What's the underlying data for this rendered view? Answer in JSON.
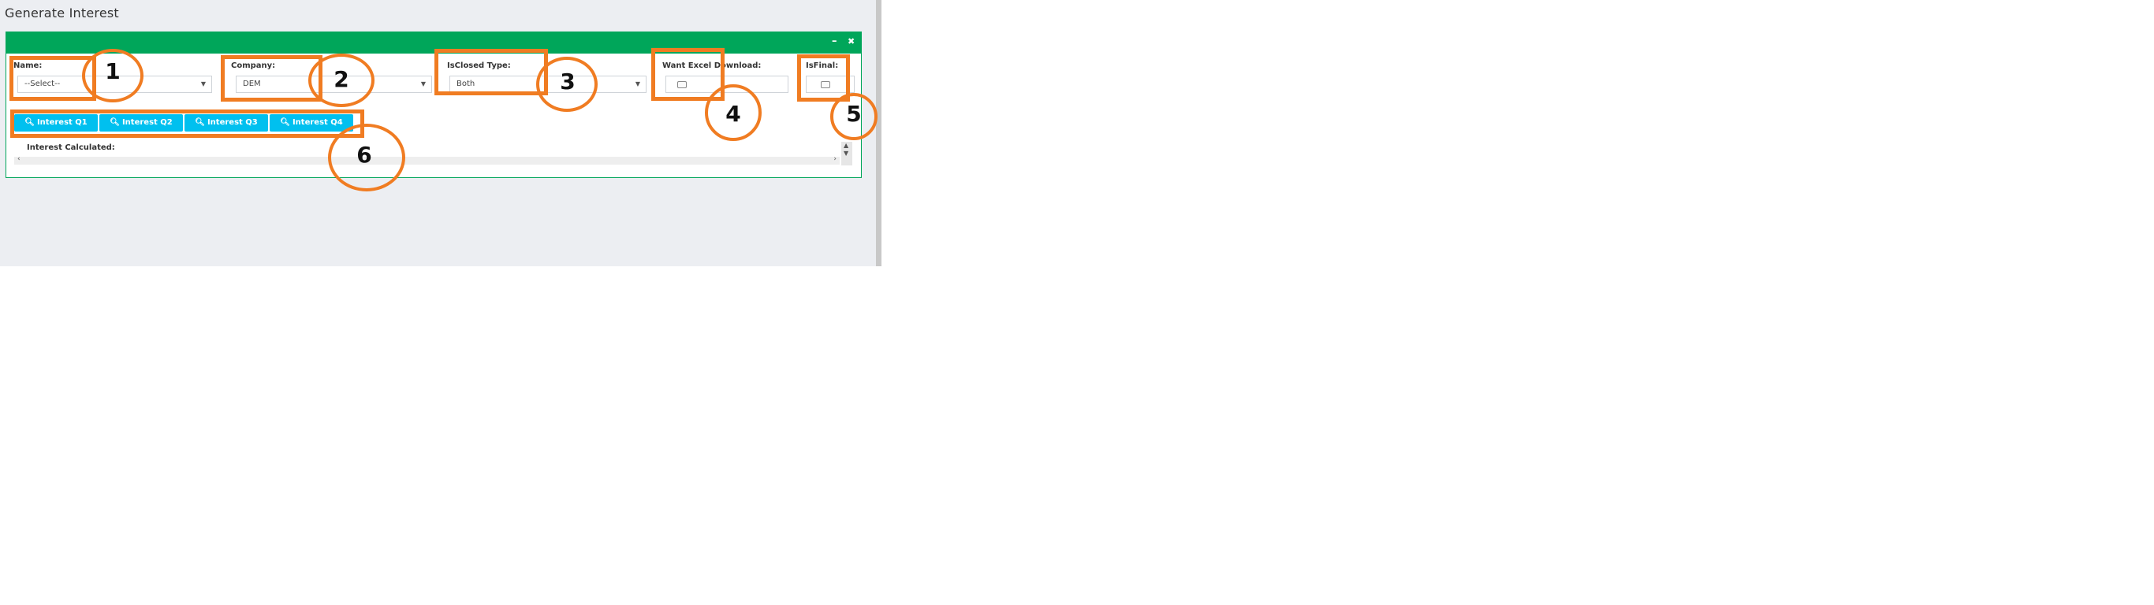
{
  "page": {
    "title": "Generate Interest"
  },
  "panel": {
    "header_controls": {
      "minimize": "–",
      "close": "✖"
    },
    "fields": {
      "name": {
        "label": "Name:",
        "value": "--Select--"
      },
      "company": {
        "label": "Company:",
        "value": "DEM"
      },
      "isclosed": {
        "label": "IsClosed Type:",
        "value": "Both"
      },
      "excel": {
        "label": "Want Excel Download:"
      },
      "isfinal": {
        "label": "IsFinal:"
      }
    },
    "buttons": [
      "Interest Q1",
      "Interest Q2",
      "Interest Q3",
      "Interest Q4"
    ],
    "result_label": "Interest Calculated:"
  },
  "icons": {
    "search": "search-icon",
    "chevron": "chevron-down-icon",
    "minimize": "minimize-icon",
    "close": "close-icon"
  },
  "annotations": [
    "1",
    "2",
    "3",
    "4",
    "5",
    "6"
  ],
  "colors": {
    "header": "#00a65a",
    "button": "#00c0ef",
    "annotation": "#f07c22",
    "background": "#eceef2"
  }
}
